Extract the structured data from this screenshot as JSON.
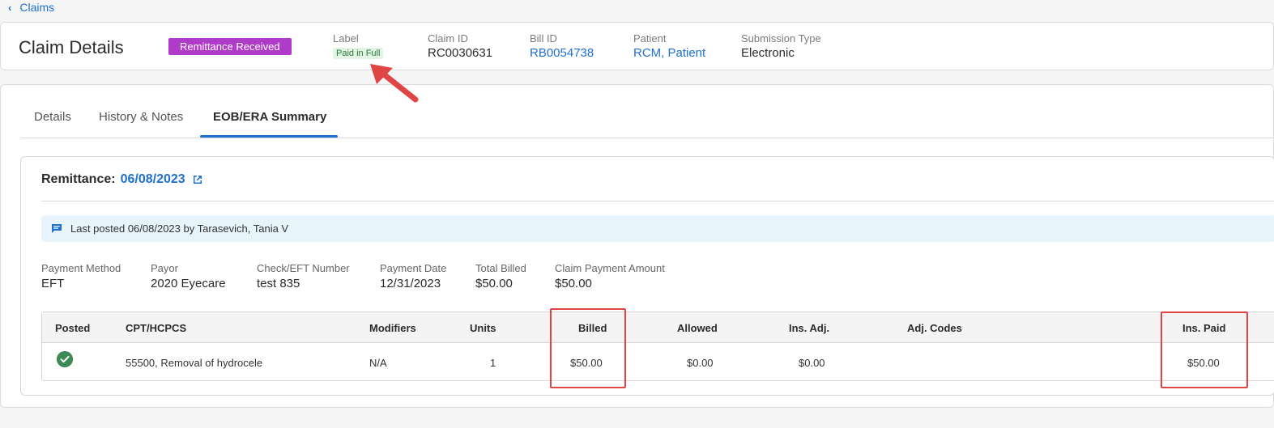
{
  "nav": {
    "back_label": "Claims"
  },
  "header": {
    "title": "Claim Details",
    "status": "Remittance Received",
    "label_caption": "Label",
    "label_value": "Paid in Full",
    "claim_id_caption": "Claim ID",
    "claim_id": "RC0030631",
    "bill_id_caption": "Bill ID",
    "bill_id": "RB0054738",
    "patient_caption": "Patient",
    "patient": "RCM, Patient",
    "submission_caption": "Submission Type",
    "submission": "Electronic"
  },
  "tabs": [
    {
      "label": "Details"
    },
    {
      "label": "History & Notes"
    },
    {
      "label": "EOB/ERA Summary"
    }
  ],
  "remittance": {
    "prefix": "Remittance:",
    "date": "06/08/2023",
    "banner": "Last posted 06/08/2023 by Tarasevich, Tania V",
    "fields": [
      {
        "label": "Payment Method",
        "value": "EFT"
      },
      {
        "label": "Payor",
        "value": "2020 Eyecare"
      },
      {
        "label": "Check/EFT Number",
        "value": "test 835"
      },
      {
        "label": "Payment Date",
        "value": "12/31/2023"
      },
      {
        "label": "Total Billed",
        "value": "$50.00"
      },
      {
        "label": "Claim Payment Amount",
        "value": "$50.00"
      }
    ]
  },
  "table": {
    "headers": [
      "Posted",
      "CPT/HCPCS",
      "Modifiers",
      "Units",
      "Billed",
      "Allowed",
      "Ins. Adj.",
      "Adj. Codes",
      "Ins. Paid"
    ],
    "rows": [
      {
        "cpt": "55500, Removal of hydrocele",
        "modifiers": "N/A",
        "units": "1",
        "billed": "$50.00",
        "allowed": "$0.00",
        "ins_adj": "$0.00",
        "adj_codes": "",
        "ins_paid": "$50.00"
      }
    ]
  },
  "colors": {
    "accent": "#1f6fcf",
    "status_badge": "#b03bc8",
    "highlight": "#e04545",
    "posted_check": "#3d8a55"
  }
}
